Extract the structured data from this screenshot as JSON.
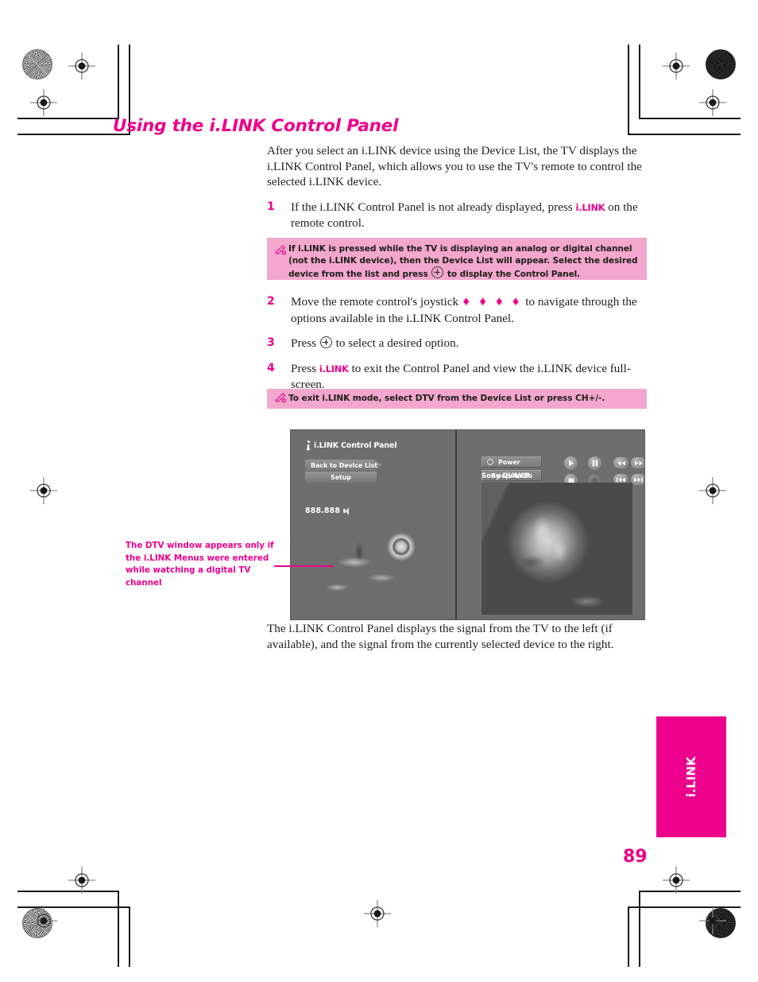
{
  "page": {
    "title": "Using the i.LINK Control Panel",
    "folio": "89",
    "thumb_tab_label": "i.LINK",
    "accent_color": "#ec008c",
    "note_bg_color": "#f3a7cd",
    "body_text_color": "#231f20"
  },
  "intro": {
    "paragraph": "After you select an i.LINK device using the Device List, the TV displays the i.LINK Control Panel, which allows you to use the TV's remote to control the selected i.LINK device."
  },
  "steps": [
    {
      "number": "1",
      "text_before": "If the i.LINK Control Panel is not already displayed, press ",
      "keyword": "i.LINK",
      "text_after": " on the remote control."
    },
    {
      "number": "2",
      "text_before": "Move the remote control's joystick ",
      "joystick": "♦ ♦ ♦ ♦",
      "text_after": " to navigate through the options available in the i.LINK Control Panel."
    },
    {
      "number": "3",
      "text_before": "Press ",
      "text_after": " to select a desired option."
    },
    {
      "number": "4",
      "text_before": "Press ",
      "keyword": "i.LINK",
      "text_after": " to exit the Control Panel and view the i.LINK device full-screen."
    }
  ],
  "notes": [
    {
      "icon": "note-pencil-icon",
      "text": "If i.LINK is pressed while the TV is displaying an analog or digital channel (not the i.LINK device), then the Device List will appear. Select the desired device from the list and press",
      "text_tail": "to display the Control Panel."
    },
    {
      "icon": "note-pencil-icon",
      "text": "To exit i.LINK mode, select DTV from the Device List or press CH+/-."
    }
  ],
  "figure": {
    "panel_title": "i.LINK Control Panel",
    "left_buttons": [
      {
        "label": "Back to Device List"
      },
      {
        "label": "Setup"
      }
    ],
    "channel_display": "888.888",
    "device_buttons": [
      {
        "label": "Power"
      },
      {
        "label": "Swap Audio"
      }
    ],
    "device_name": "Sony DV-VCR",
    "transport_buttons": [
      {
        "name": "play",
        "glyph": "▶"
      },
      {
        "name": "pause",
        "glyph": "▐▌"
      },
      {
        "name": "rewind",
        "glyph": "◀◀"
      },
      {
        "name": "fast-forward",
        "glyph": "▶▶"
      },
      {
        "name": "stop",
        "glyph": "■"
      },
      {
        "name": "record",
        "glyph": ""
      },
      {
        "name": "skip-previous",
        "glyph": "▌◀◀"
      },
      {
        "name": "skip-next",
        "glyph": "▶▶▌"
      }
    ]
  },
  "callout": {
    "text": "The DTV window appears only if the i.LINK Menus were entered while watching a digital TV channel"
  },
  "closing": {
    "paragraph": "The i.LINK Control Panel displays the signal from the TV to the left (if available), and the signal from the currently selected device to the right."
  }
}
